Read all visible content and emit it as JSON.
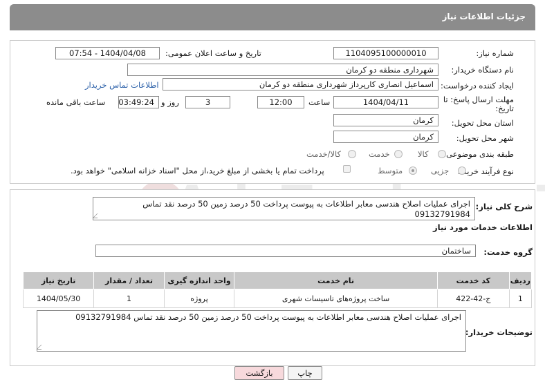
{
  "header": {
    "title": "جزئیات اطلاعات نیاز"
  },
  "form": {
    "need_number_label": "شماره نیاز:",
    "need_number": "1104095100000010",
    "announce_label": "تاریخ و ساعت اعلان عمومی:",
    "announce_value": "1404/04/08 - 07:54",
    "buyer_org_label": "نام دستگاه خریدار:",
    "buyer_org": "شهرداری منطقه دو کرمان",
    "creator_label": "ایجاد کننده درخواست:",
    "creator": "اسماعیل انصاری کارپرداز شهرداری منطقه دو کرمان",
    "contact_link": "اطلاعات تماس خریدار",
    "deadline_label_1": "مهلت ارسال پاسخ: تا",
    "deadline_label_2": "تاریخ:",
    "deadline_date": "1404/04/11",
    "time_label": "ساعت",
    "deadline_time": "12:00",
    "days_value": "3",
    "days_label": "روز و",
    "remaining_time": "03:49:24",
    "remaining_label": "ساعت باقی مانده",
    "province_label": "استان محل تحویل:",
    "province": "کرمان",
    "city_label": "شهر محل تحویل:",
    "city": "کرمان",
    "category_label": "طبقه بندی موضوعی:",
    "category_options": [
      "کالا",
      "خدمت",
      "کالا/خدمت"
    ],
    "purchase_type_label": "نوع فرآیند خرید :",
    "purchase_options": [
      "جزیی",
      "متوسط"
    ],
    "payment_note": "پرداخت تمام یا بخشی از مبلغ خرید،از محل \"اسناد خزانه اسلامی\" خواهد بود."
  },
  "general": {
    "description_label": "شرح کلی نیاز:",
    "description": "اجرای عملیات اصلاح هندسی معابر اطلاعات به پیوست پرداخت 50 درصد زمین  50 درصد نقد  تماس 09132791984",
    "services_title": "اطلاعات خدمات مورد نیاز",
    "service_group_label": "گروه خدمت:",
    "service_group": "ساختمان"
  },
  "table": {
    "headers": [
      "ردیف",
      "کد خدمت",
      "نام خدمت",
      "واحد اندازه گیری",
      "تعداد / مقدار",
      "تاریخ نیاز"
    ],
    "rows": [
      [
        "1",
        "ج-42-422",
        "ساخت پروژه‌های تاسیسات شهری",
        "پروژه",
        "1",
        "1404/05/30"
      ]
    ]
  },
  "buyer_notes": {
    "label": "توضیحات خریدار:",
    "text": "اجرای عملیات اصلاح هندسی معابر اطلاعات به پیوست پرداخت 50 درصد زمین  50 درصد نقد  تماس 09132791984"
  },
  "buttons": {
    "print": "چاپ",
    "back": "بازگشت"
  },
  "watermark": "AriaTender.neT",
  "colors": {
    "header_bg": "#8c8c8c",
    "back_button_bg": "#f7d9dc",
    "link": "#2a5fa8"
  }
}
